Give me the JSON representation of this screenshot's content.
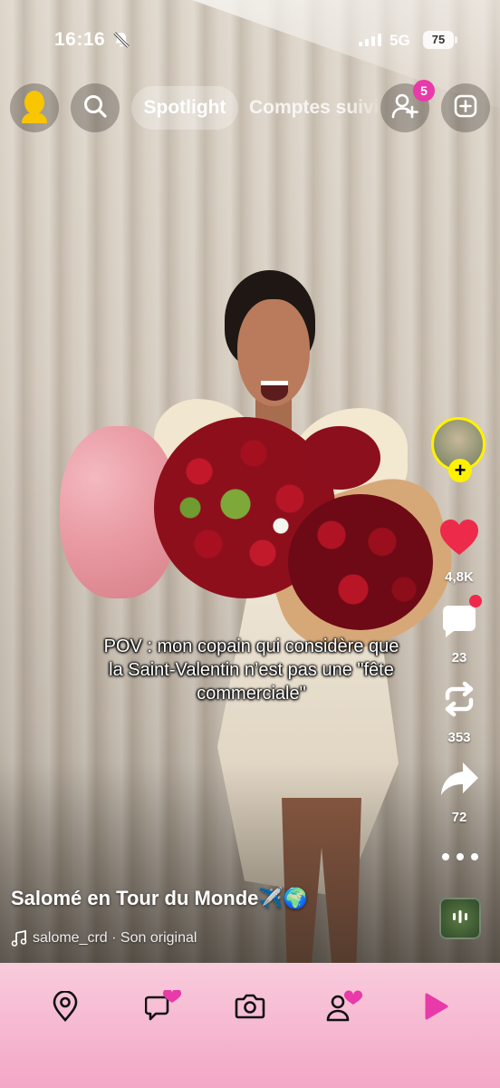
{
  "status_bar": {
    "time": "16:16",
    "network": "5G",
    "battery": "75",
    "icons": [
      "bell-off-icon",
      "signal-icon"
    ]
  },
  "top_nav": {
    "tabs": [
      {
        "label": "Spotlight",
        "active": true
      },
      {
        "label": "Comptes suivis",
        "active": false
      }
    ],
    "friend_requests_count": "5",
    "icons": [
      "bitmoji-icon",
      "search-icon",
      "add-friend-icon",
      "create-icon"
    ]
  },
  "actions": {
    "likes": "4,8K",
    "comments": "23",
    "remixes": "353",
    "shares": "72",
    "icons": [
      "heart-icon",
      "comment-icon",
      "remix-icon",
      "share-icon",
      "more-icon"
    ]
  },
  "caption": {
    "line1": "POV : mon copain qui considère que",
    "line2": "la Saint-Valentin n’est pas une \"fête",
    "line3": "commerciale\""
  },
  "creator": {
    "name": "Salomé en Tour du Monde✈️🌍",
    "sound": "salome_crd · Son original"
  },
  "bottom_nav": {
    "items": [
      "map-icon",
      "chat-icon",
      "camera-icon",
      "stories-icon",
      "spotlight-icon"
    ],
    "accent": "#e83aa8",
    "background": "#f5b2cc"
  },
  "colors": {
    "follow_ring": "#fff200",
    "like": "#ee2a4a",
    "badge": "#e83aa8"
  }
}
